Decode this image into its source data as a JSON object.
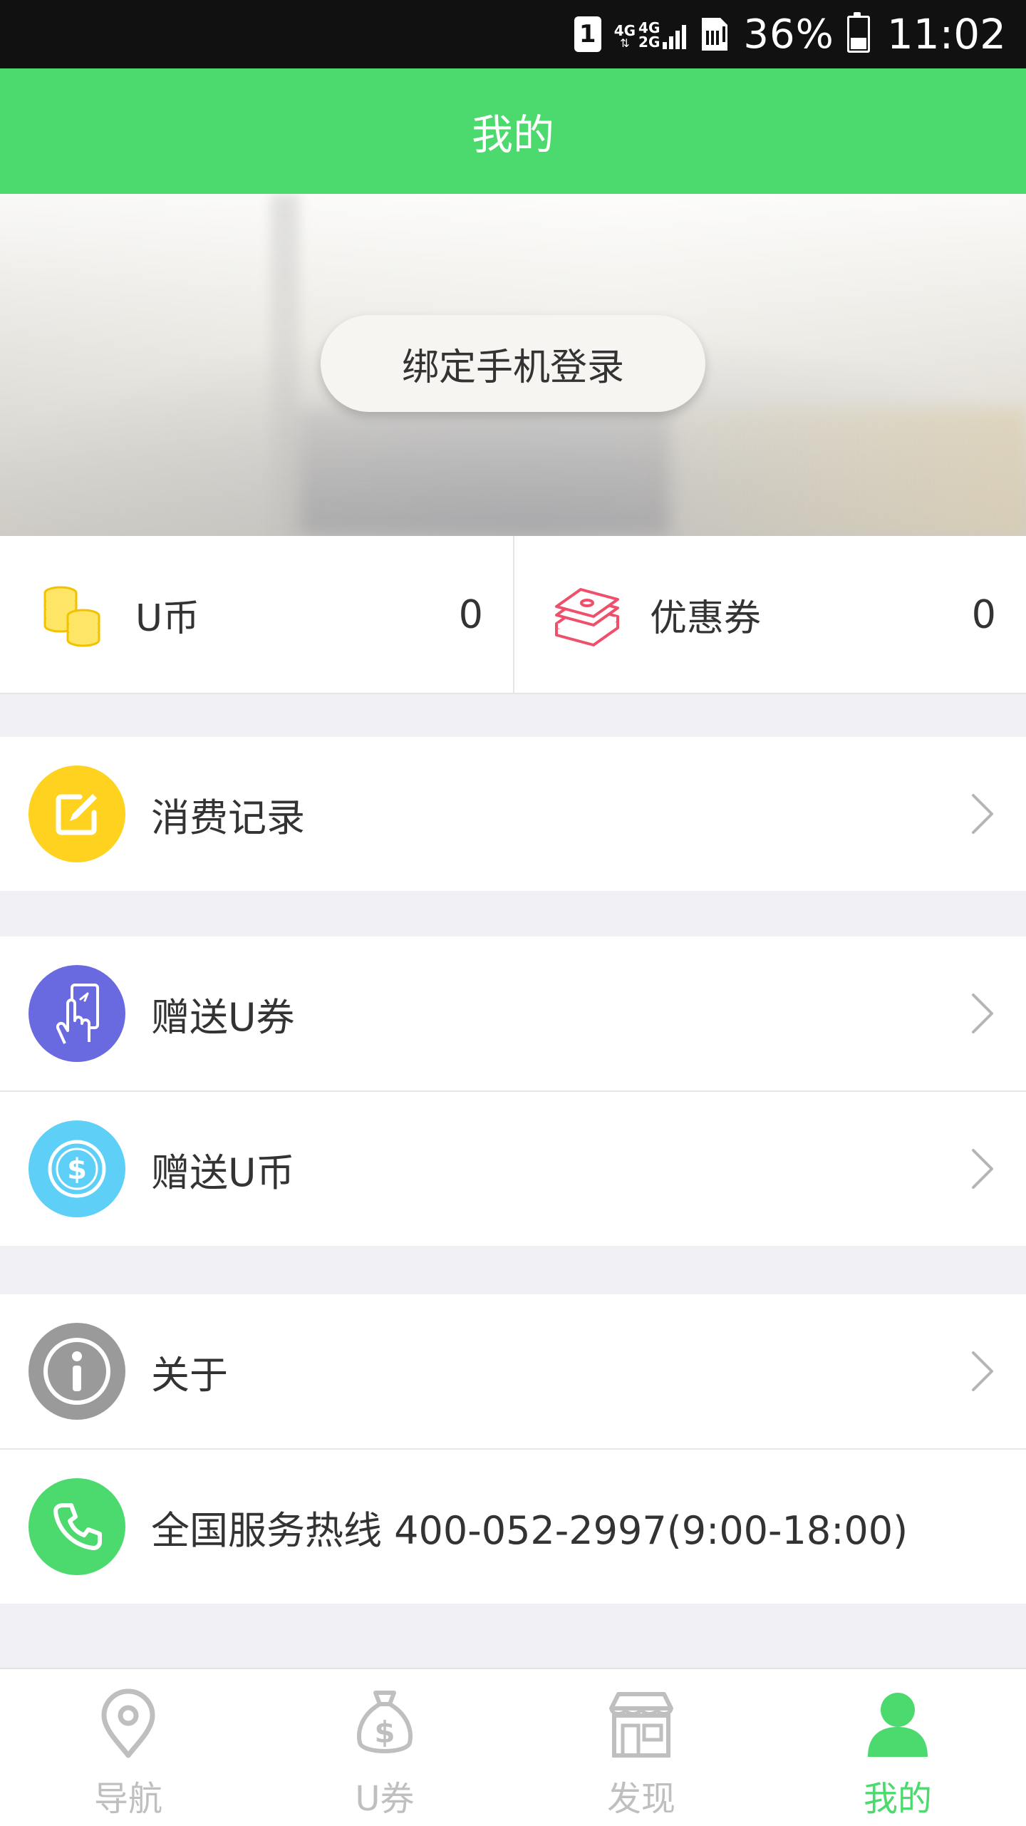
{
  "status_bar": {
    "sim": "1",
    "net1": "4G",
    "net2": "4G",
    "net3": "2G",
    "battery": "36%",
    "time": "11:02"
  },
  "header": {
    "title": "我的"
  },
  "hero": {
    "login_button": "绑定手机登录"
  },
  "assets": {
    "coins": {
      "label": "U币",
      "value": "0",
      "icon": "coins-icon"
    },
    "coupons": {
      "label": "优惠券",
      "value": "0",
      "icon": "coupon-stack-icon"
    }
  },
  "menu": {
    "records": {
      "label": "消费记录",
      "icon": "edit-icon",
      "color": "#ffd21f"
    },
    "gift_coupon": {
      "label": "赠送U券",
      "icon": "hand-swipe-icon",
      "color": "#6a6ae0"
    },
    "gift_coin": {
      "label": "赠送U币",
      "icon": "dollar-coin-icon",
      "color": "#5ecff7"
    },
    "about": {
      "label": "关于",
      "icon": "info-icon",
      "color": "#9a9a9a"
    },
    "hotline": {
      "label": "全国服务热线 400-052-2997(9:00-18:00)",
      "icon": "phone-icon",
      "color": "#4cd96e"
    }
  },
  "bottom_nav": {
    "items": [
      {
        "label": "导航",
        "icon": "location-pin-icon"
      },
      {
        "label": "U券",
        "icon": "money-bag-icon"
      },
      {
        "label": "发现",
        "icon": "storefront-icon"
      },
      {
        "label": "我的",
        "icon": "person-icon"
      }
    ],
    "active_color": "#4cd96e",
    "inactive_color": "#bfbfbf"
  },
  "colors": {
    "brand_green": "#4cd96e",
    "background": "#efeff4"
  }
}
